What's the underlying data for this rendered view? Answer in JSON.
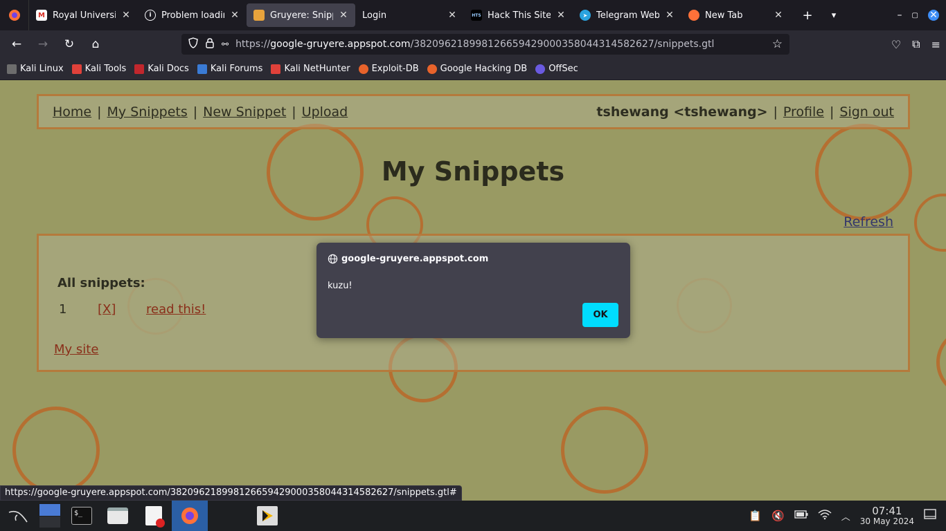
{
  "browser": {
    "tabs": [
      {
        "title": "Royal University",
        "favicon": "gmail-icon",
        "active": false
      },
      {
        "title": "Problem loading",
        "favicon": "info-icon",
        "active": false
      },
      {
        "title": "Gruyere: Snippets",
        "favicon": "gruyere-icon",
        "active": true
      },
      {
        "title": "Login",
        "favicon": "",
        "active": false
      },
      {
        "title": "Hack This Site",
        "favicon": "hts-icon",
        "active": false
      },
      {
        "title": "Telegram Web",
        "favicon": "telegram-icon",
        "active": false
      },
      {
        "title": "New Tab",
        "favicon": "firefox-icon",
        "active": false
      }
    ],
    "url_prefix": "https://",
    "url_host": "google-gruyere.appspot.com",
    "url_path": "/382096218998126659429000358044314582627/snippets.gtl",
    "bookmarks": [
      {
        "label": "Kali Linux",
        "color": "#e0e0e0"
      },
      {
        "label": "Kali Tools",
        "color": "#e0413a"
      },
      {
        "label": "Kali Docs",
        "color": "#c1272d"
      },
      {
        "label": "Kali Forums",
        "color": "#3a7bd5"
      },
      {
        "label": "Kali NetHunter",
        "color": "#e0413a"
      },
      {
        "label": "Exploit-DB",
        "color": "#e8632b"
      },
      {
        "label": "Google Hacking DB",
        "color": "#e8632b"
      },
      {
        "label": "OffSec",
        "color": "#6a5ae0"
      }
    ],
    "status_url": "https://google-gruyere.appspot.com/382096218998126659429000358044314582627/snippets.gtl#"
  },
  "page": {
    "menu": {
      "home": "Home",
      "my_snippets": "My Snippets",
      "new_snippet": "New Snippet",
      "upload": "Upload",
      "user": "tshewang <tshewang>",
      "profile": "Profile",
      "sign_out": "Sign out",
      "sep": "|"
    },
    "title": "My Snippets",
    "refresh": "Refresh",
    "all_snippets": "All snippets:",
    "snippets": [
      {
        "num": "1",
        "delete": "[X]",
        "text": "read this!"
      }
    ],
    "my_site": "My site"
  },
  "dialog": {
    "origin": "google-gruyere.appspot.com",
    "message": "kuzu!",
    "ok": "OK"
  },
  "taskbar": {
    "time": "07:41",
    "date": "30 May 2024"
  }
}
